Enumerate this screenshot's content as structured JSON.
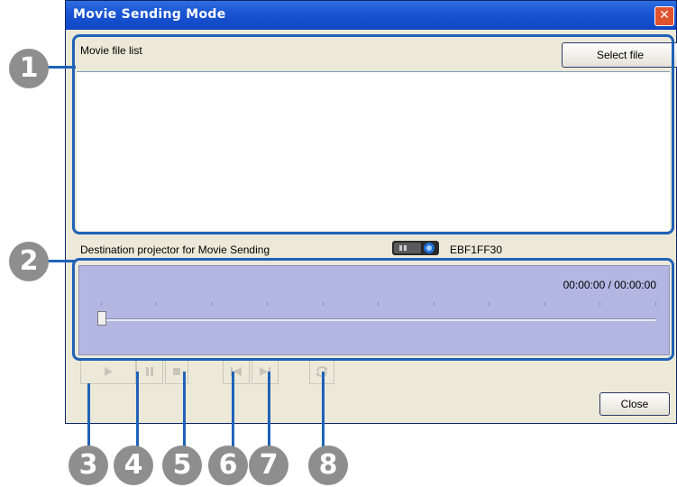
{
  "window": {
    "title": "Movie Sending Mode",
    "close_glyph": "✕"
  },
  "movie_list": {
    "label": "Movie file list",
    "select_file_label": "Select file"
  },
  "destination": {
    "label": "Destination projector for Movie Sending",
    "projector_name": "EBF1FF30",
    "projector_icon": "projector-icon"
  },
  "playback": {
    "time": "00:00:00 / 00:00:00",
    "position": 0
  },
  "controls": {
    "play_icon": "play-icon",
    "pause_icon": "pause-icon",
    "stop_icon": "stop-icon",
    "previous_icon": "previous-icon",
    "next_icon": "next-icon",
    "repeat_icon": "repeat-icon",
    "close_label": "Close"
  },
  "callouts": [
    "1",
    "2",
    "3",
    "4",
    "5",
    "6",
    "7",
    "8"
  ],
  "colors": {
    "accent": "#1f62b8",
    "callout_circle": "#8e8e8e",
    "playback_panel": "#b4b6e2",
    "titlebar": "#1a55d4"
  }
}
